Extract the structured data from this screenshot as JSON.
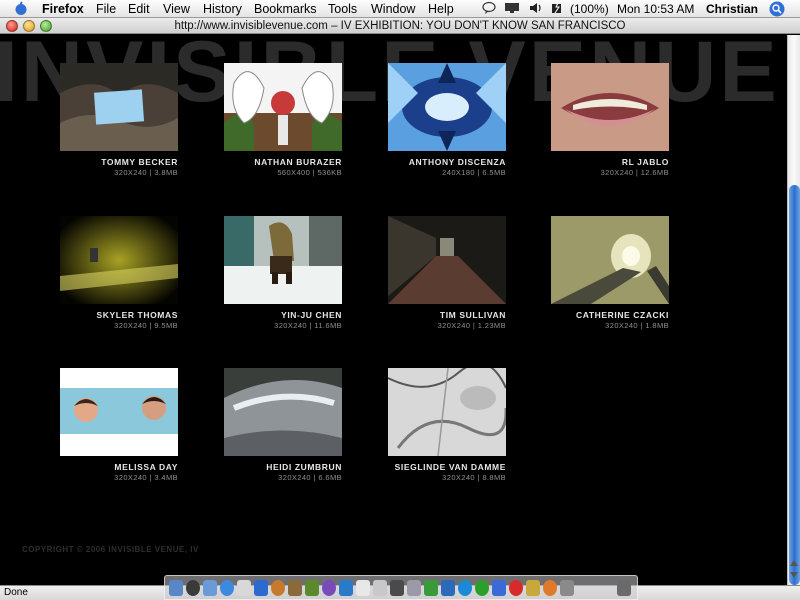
{
  "menubar": {
    "app_name": "Firefox",
    "menus": [
      "File",
      "Edit",
      "View",
      "History",
      "Bookmarks",
      "Tools",
      "Window",
      "Help"
    ],
    "battery": "(100%)",
    "clock": "Mon 10:53 AM",
    "user": "Christian"
  },
  "window": {
    "title": "http://www.invisiblevenue.com – IV EXHIBITION: YOU DON'T KNOW SAN FRANCISCO"
  },
  "page": {
    "background_title": "INVISIBLE VENUE",
    "copyright": "COPYRIGHT © 2006 INVISIBLE VENUE, IV",
    "items": [
      {
        "artist": "TOMMY BECKER",
        "meta": "320X240 | 3.8MB"
      },
      {
        "artist": "NATHAN BURAZER",
        "meta": "560X400 | 536KB"
      },
      {
        "artist": "ANTHONY DISCENZA",
        "meta": "240X180 | 6.5MB"
      },
      {
        "artist": "RL JABLO",
        "meta": "320X240 | 12.6MB"
      },
      {
        "artist": "SKYLER THOMAS",
        "meta": "320X240 | 9.5MB"
      },
      {
        "artist": "YIN-JU CHEN",
        "meta": "320X240 | 11.6MB"
      },
      {
        "artist": "TIM SULLIVAN",
        "meta": "320X240 | 1.23MB"
      },
      {
        "artist": "CATHERINE CZACKI",
        "meta": "320X240 | 1.8MB"
      },
      {
        "artist": "MELISSA DAY",
        "meta": "320X240 | 3.4MB"
      },
      {
        "artist": "HEIDI ZUMBRUN",
        "meta": "320X240 | 6.6MB"
      },
      {
        "artist": "SIEGLINDE VAN DAMME",
        "meta": "320X240 | 8.8MB"
      }
    ]
  },
  "statusbar": {
    "text": "Done"
  },
  "colors": {
    "page_bg": "#000000",
    "artist_text": "#e6e6e6",
    "meta_text": "#8f8f8f",
    "scroll_thumb": "#2a6fd0"
  }
}
